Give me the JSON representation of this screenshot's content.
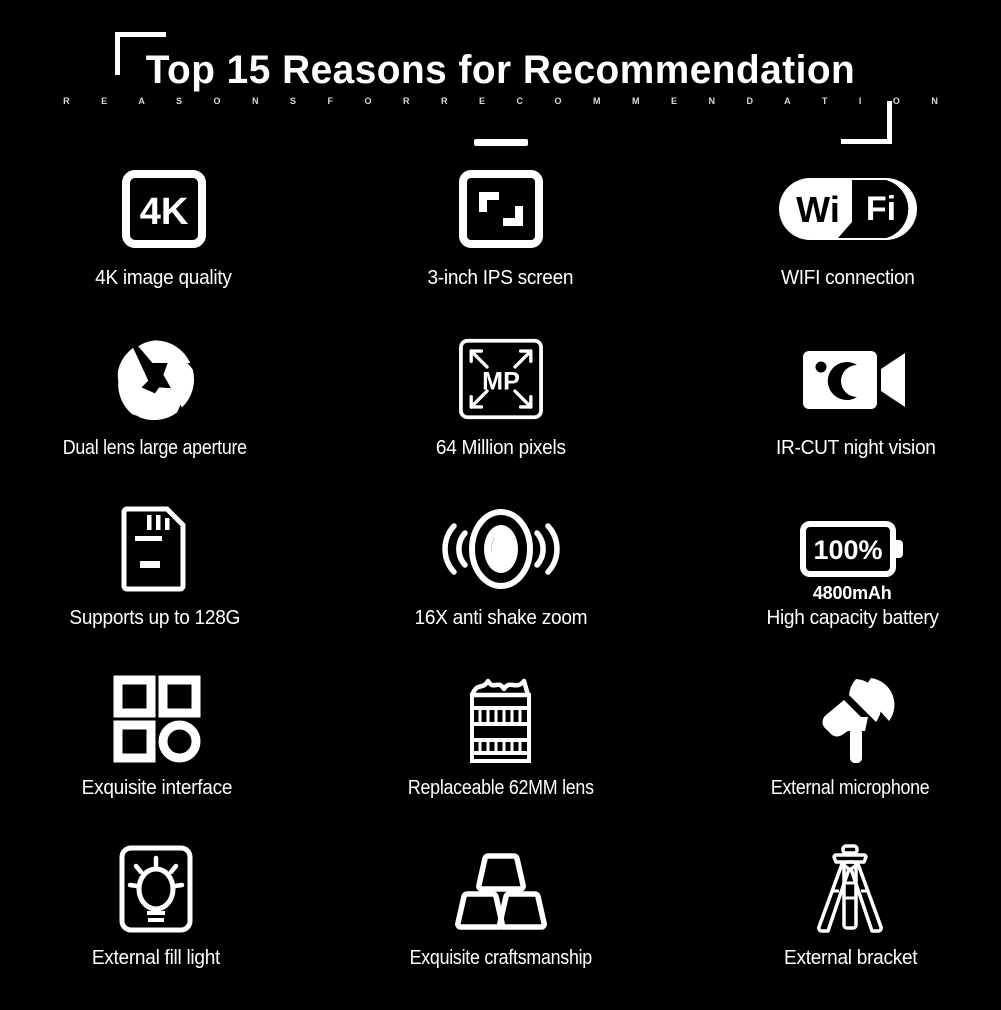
{
  "background_color": "#000000",
  "foreground_color": "#ffffff",
  "header": {
    "title": "Top 15 Reasons for Recommendation",
    "subtitle": "R E A S O N S  F O R  R E C O M M E N D A T I O N",
    "divider": "divider-bar",
    "bracket_top_left": "corner-bracket",
    "bracket_bottom_right": "corner-bracket"
  },
  "features": {
    "rows": [
      {
        "cells": [
          {
            "icon": "4k-badge-icon",
            "icon_text": "4K",
            "label": "4K image quality"
          },
          {
            "icon": "screen-frame-icon",
            "label": "3-inch IPS screen"
          },
          {
            "icon": "wifi-logo-icon",
            "icon_text_1": "Wi",
            "icon_text_2": "Fi",
            "label": "WIFI connection"
          }
        ]
      },
      {
        "cells": [
          {
            "icon": "aperture-shutter-icon",
            "label": "Dual lens large aperture"
          },
          {
            "icon": "megapixel-box-icon",
            "icon_text": "MP",
            "label": "64 Million pixels"
          },
          {
            "icon": "night-vision-camcorder-icon",
            "label": "IR-CUT night vision"
          }
        ]
      },
      {
        "cells": [
          {
            "icon": "sd-card-icon",
            "label": "Supports up to 128G"
          },
          {
            "icon": "anti-shake-lens-icon",
            "label": "16X anti shake zoom"
          },
          {
            "icon": "battery-icon",
            "icon_text": "100%",
            "sublabel": "4800mAh",
            "label": "High capacity battery"
          }
        ]
      },
      {
        "cells": [
          {
            "icon": "interface-ports-icon",
            "label": "Exquisite interface"
          },
          {
            "icon": "camera-lens-barrel-icon",
            "label": "Replaceable 62MM lens"
          },
          {
            "icon": "microphone-icon",
            "label": "External microphone"
          }
        ]
      },
      {
        "cells": [
          {
            "icon": "fill-light-panel-icon",
            "label": "External fill light"
          },
          {
            "icon": "gold-ingots-icon",
            "label": "Exquisite craftsmanship"
          },
          {
            "icon": "tripod-icon",
            "label": "External bracket"
          }
        ]
      }
    ]
  }
}
